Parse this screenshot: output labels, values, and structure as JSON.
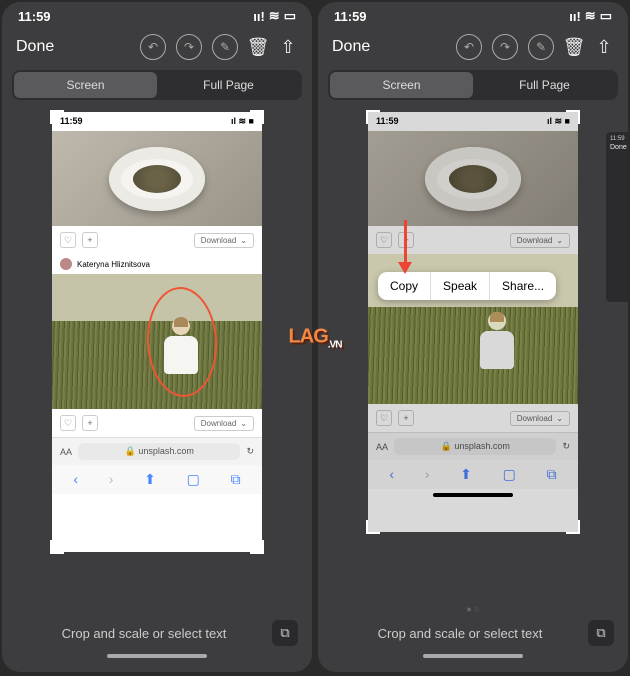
{
  "status": {
    "time": "11:59",
    "signal": "ıı!",
    "wifi": "≋",
    "batt": "▭"
  },
  "toolbar": {
    "done": "Done"
  },
  "tabs": {
    "screen": "Screen",
    "full": "Full Page"
  },
  "inner": {
    "time": "11:59",
    "author": "Kateryna Hliznitsova",
    "download": "Download",
    "url": "unsplash.com",
    "font": "AA",
    "lock": "🔒"
  },
  "popup": {
    "copy": "Copy",
    "speak": "Speak",
    "share": "Share..."
  },
  "bottom": {
    "hint": "Crop and scale or select text"
  },
  "thumb": {
    "done": "Done"
  },
  "logo": "LAG",
  "logo2": ".VN"
}
